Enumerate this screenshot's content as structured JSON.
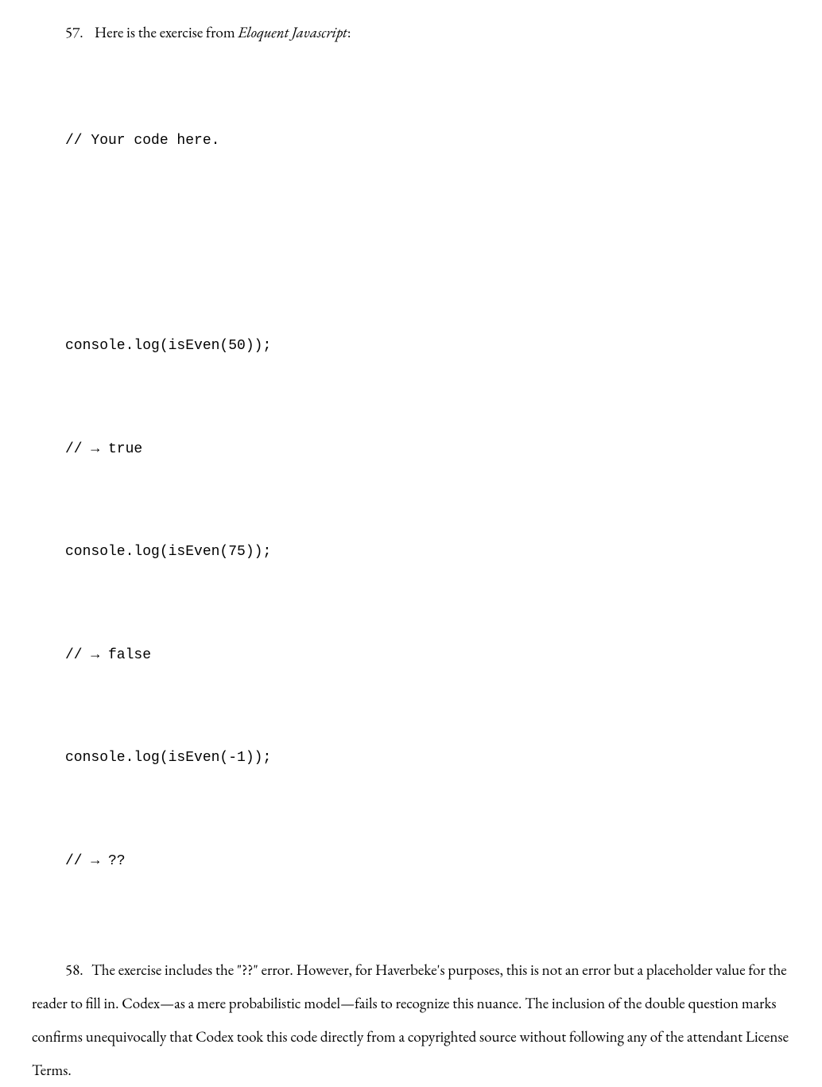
{
  "paragraphs": {
    "p57": {
      "num": "57.",
      "text_before": "Here is the exercise from ",
      "italic_text": "Eloquent Javascript",
      "text_after": ":"
    },
    "p58": {
      "num": "58.",
      "text": "The exercise includes the \"??\" error. However, for Haverbeke's purposes, this is not an error but a placeholder value for the reader to fill in. Codex—as a mere probabilistic model—fails to recognize this nuance. The inclusion of the double question marks confirms unequivocally that Codex took this code directly from a copyrighted source without following any of the attendant License Terms."
    }
  },
  "code": {
    "line1": "// Your code here.",
    "line2": "console.log(isEven(50));",
    "line3": "// → true",
    "line4": "console.log(isEven(75));",
    "line5": "// → false",
    "line6": "console.log(isEven(-1));",
    "line7": "// → ??"
  }
}
